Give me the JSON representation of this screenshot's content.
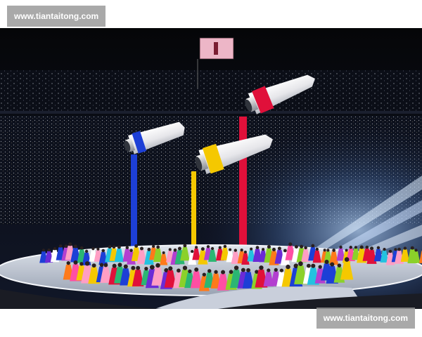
{
  "watermarks": {
    "top": "www.tiantaitong.com",
    "bottom": "www.tiantaitong.com"
  },
  "scene": {
    "subject": "stadium-ceremony-with-giant-paint-tubes",
    "paint_colors": {
      "blue": "#1d3fd6",
      "red": "#e0103a",
      "yellow": "#f5c800"
    }
  }
}
